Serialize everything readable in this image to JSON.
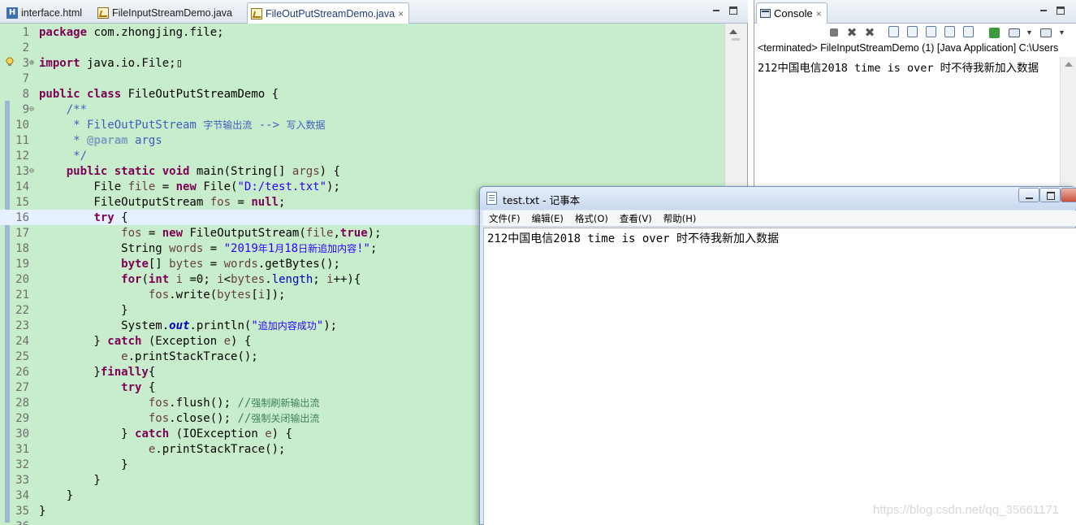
{
  "editor": {
    "tabs": [
      {
        "label": "interface.html",
        "icon": "html-file-icon",
        "active": false
      },
      {
        "label": "FileInputStreamDemo.java",
        "icon": "java-file-icon",
        "active": false
      },
      {
        "label": "FileOutPutStreamDemo.java",
        "icon": "java-file-icon",
        "active": true
      }
    ],
    "close_glyph": "×",
    "current_line": 16,
    "lines": [
      {
        "n": "1",
        "fold": "",
        "html": "<span class=\"kw\">package</span> com.zhongjing.file;"
      },
      {
        "n": "2",
        "fold": "",
        "html": ""
      },
      {
        "n": "3",
        "fold": "⊕",
        "html": "<span class=\"kw\">import</span> java.io.File;&#x25AF;"
      },
      {
        "n": "7",
        "fold": "",
        "html": ""
      },
      {
        "n": "8",
        "fold": "",
        "html": "<span class=\"kw\">public</span> <span class=\"kw\">class</span> FileOutPutStreamDemo {"
      },
      {
        "n": "9",
        "fold": "⊖",
        "html": "    <span class=\"jdoc\">/**</span>"
      },
      {
        "n": "10",
        "fold": "",
        "html": "<span class=\"jdoc\">     * FileOutPutStream <span class=\"cjk\">字节输出流</span> --&gt; <span class=\"cjk\">写入数据</span></span>"
      },
      {
        "n": "11",
        "fold": "",
        "html": "<span class=\"jdoc\">     * <span class=\"tag\">@param</span> args</span>"
      },
      {
        "n": "12",
        "fold": "",
        "html": "<span class=\"jdoc\">     */</span>"
      },
      {
        "n": "13",
        "fold": "⊖",
        "html": "    <span class=\"kw\">public</span> <span class=\"kw\">static</span> <span class=\"kw\">void</span> main(String[] <span class=\"var\">args</span>) {"
      },
      {
        "n": "14",
        "fold": "",
        "html": "        File <span class=\"var\">file</span> = <span class=\"kw\">new</span> File(<span class=\"str\">\"D:/test.txt\"</span>);"
      },
      {
        "n": "15",
        "fold": "",
        "html": "        FileOutputStream <span class=\"var\">fos</span> = <span class=\"kw\">null</span>;"
      },
      {
        "n": "16",
        "fold": "",
        "html": "        <span class=\"kw\">try</span> {"
      },
      {
        "n": "17",
        "fold": "",
        "html": "            <span class=\"var\">fos</span> = <span class=\"kw\">new</span> FileOutputStream(<span class=\"var\">file</span>,<span class=\"kw\">true</span>);"
      },
      {
        "n": "18",
        "fold": "",
        "html": "            String <span class=\"var\">words</span> = <span class=\"str\">\"2019<span class=\"cjk\">年</span>1<span class=\"cjk\">月</span>18<span class=\"cjk\">日新追加内容</span>!\"</span>;"
      },
      {
        "n": "19",
        "fold": "",
        "html": "            <span class=\"kw\">byte</span>[] <span class=\"var\">bytes</span> = <span class=\"var\">words</span>.getBytes();"
      },
      {
        "n": "20",
        "fold": "",
        "html": "            <span class=\"kw\">for</span>(<span class=\"kw\">int</span> <span class=\"var\">i</span> =0; <span class=\"var\">i</span>&lt;<span class=\"var\">bytes</span>.<span class=\"fldv\">length</span>; <span class=\"var\">i</span>++){"
      },
      {
        "n": "21",
        "fold": "",
        "html": "                <span class=\"var\">fos</span>.write(<span class=\"var\">bytes</span>[<span class=\"var\">i</span>]);"
      },
      {
        "n": "22",
        "fold": "",
        "html": "            }"
      },
      {
        "n": "23",
        "fold": "",
        "html": "            System.<span class=\"fld\">out</span>.println(<span class=\"str\">\"<span class=\"cjk\">追加内容成功</span>\"</span>);"
      },
      {
        "n": "24",
        "fold": "",
        "html": "        } <span class=\"kw\">catch</span> (Exception <span class=\"var\">e</span>) {"
      },
      {
        "n": "25",
        "fold": "",
        "html": "            <span class=\"var\">e</span>.printStackTrace();"
      },
      {
        "n": "26",
        "fold": "",
        "html": "        }<span class=\"kw\">finally</span>{"
      },
      {
        "n": "27",
        "fold": "",
        "html": "            <span class=\"kw\">try</span> {"
      },
      {
        "n": "28",
        "fold": "",
        "html": "                <span class=\"var\">fos</span>.flush(); <span class=\"cmt\">//<span class=\"cjk\">强制刷新输出流</span></span>"
      },
      {
        "n": "29",
        "fold": "",
        "html": "                <span class=\"var\">fos</span>.close(); <span class=\"cmt\">//<span class=\"cjk\">强制关闭输出流</span></span>"
      },
      {
        "n": "30",
        "fold": "",
        "html": "            } <span class=\"kw\">catch</span> (IOException <span class=\"var\">e</span>) {"
      },
      {
        "n": "31",
        "fold": "",
        "html": "                <span class=\"var\">e</span>.printStackTrace();"
      },
      {
        "n": "32",
        "fold": "",
        "html": "            }"
      },
      {
        "n": "33",
        "fold": "",
        "html": "        }"
      },
      {
        "n": "34",
        "fold": "",
        "html": "    }"
      },
      {
        "n": "35",
        "fold": "",
        "html": "}"
      },
      {
        "n": "36",
        "fold": "",
        "html": ""
      }
    ]
  },
  "console": {
    "tab_label": "Console",
    "status": "<terminated> FileInputStreamDemo (1) [Java Application] C:\\Users",
    "output": "212中国电信2018 time is over 时不待我新加入数据"
  },
  "notepad": {
    "title": "test.txt - 记事本",
    "menus": [
      "文件(F)",
      "编辑(E)",
      "格式(O)",
      "查看(V)",
      "帮助(H)"
    ],
    "content": "212中国电信2018 time is over 时不待我新加入数据"
  },
  "watermark": "https://blog.csdn.net/qq_35661171",
  "colors": {
    "editor_background": "#c7edcc",
    "keyword": "#7f0055",
    "string": "#2a00ff",
    "comment": "#3f7f5f",
    "javadoc": "#3f5fbf"
  }
}
